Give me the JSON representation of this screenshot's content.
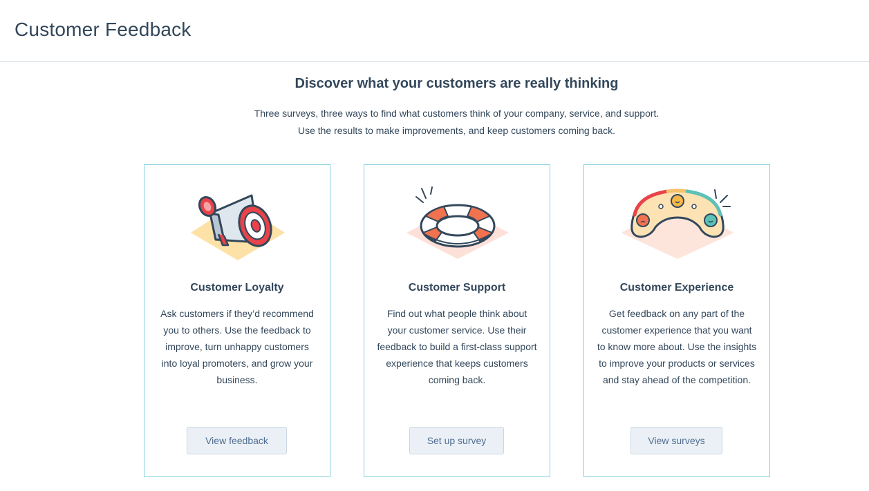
{
  "header": {
    "title": "Customer Feedback"
  },
  "hero": {
    "title": "Discover what your customers are really thinking",
    "subtitle_line1": "Three surveys, three ways to find what customers think of your company, service, and support.",
    "subtitle_line2": "Use the results to make improvements, and keep customers coming back."
  },
  "cards": [
    {
      "icon": "megaphone-icon",
      "title": "Customer Loyalty",
      "description": "Ask customers if they’d recommend you to others. Use the feedback to improve, turn unhappy customers into loyal promoters, and grow your business.",
      "button_label": "View feedback"
    },
    {
      "icon": "lifebuoy-icon",
      "title": "Customer Support",
      "description": "Find out what people think about your customer service. Use their feedback to build a first-class support experience that keeps customers coming back.",
      "button_label": "Set up survey"
    },
    {
      "icon": "satisfaction-gauge-icon",
      "title": "Customer Experience",
      "description": "Get feedback on any part of the customer experience that you want to know more about. Use the insights to improve your products or services and stay ahead of the competition.",
      "button_label": "View surveys"
    }
  ],
  "colors": {
    "text": "#33475b",
    "card_border": "#7fd1de",
    "button_bg": "#eaf0f6",
    "button_text": "#506e91",
    "accent_red": "#e8434a",
    "accent_teal": "#5cc1b6"
  }
}
